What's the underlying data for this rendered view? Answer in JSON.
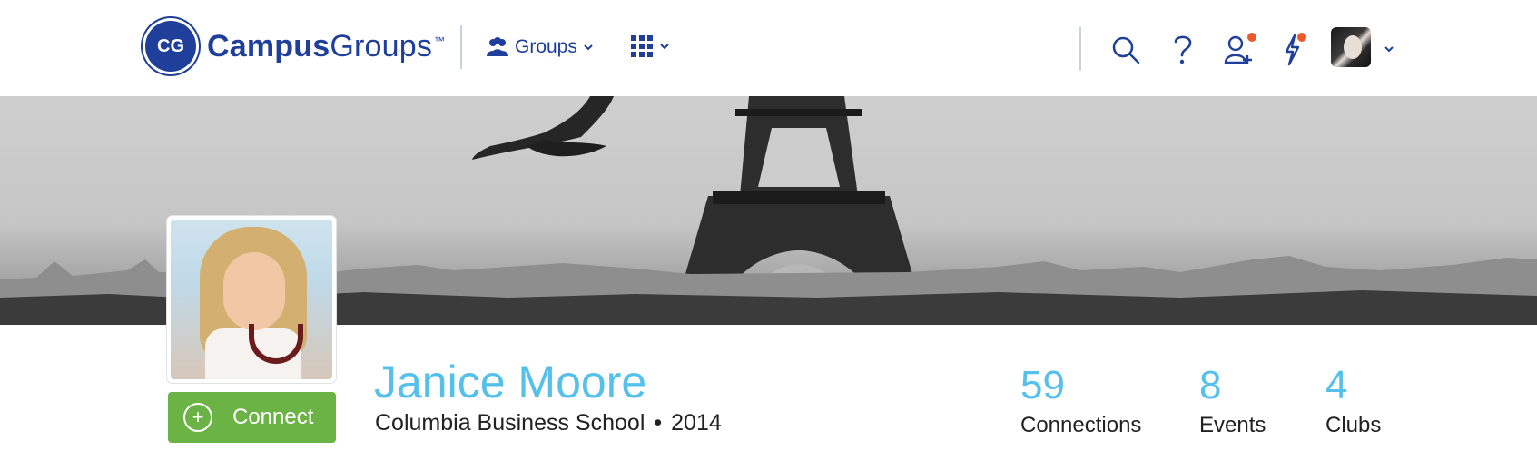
{
  "app": {
    "logo": {
      "initials": "CG",
      "brand_bold": "Campus",
      "brand_light": "Groups",
      "tm": "™"
    }
  },
  "nav": {
    "groups_label": "Groups"
  },
  "header_icons": [
    "search-icon",
    "help-icon",
    "add-user-icon",
    "activity-icon",
    "user-avatar"
  ],
  "profile": {
    "name": "Janice Moore",
    "school": "Columbia Business School",
    "separator": "•",
    "year": "2014",
    "connect_label": "Connect",
    "connect_symbol": "+",
    "stats": [
      {
        "value": "59",
        "label": "Connections"
      },
      {
        "value": "8",
        "label": "Events"
      },
      {
        "value": "4",
        "label": "Clubs"
      }
    ]
  },
  "colors": {
    "brand": "#1f3f9a",
    "accent": "#55c1eb",
    "connect": "#6ab344",
    "notification_dot": "#ea5a2a"
  }
}
